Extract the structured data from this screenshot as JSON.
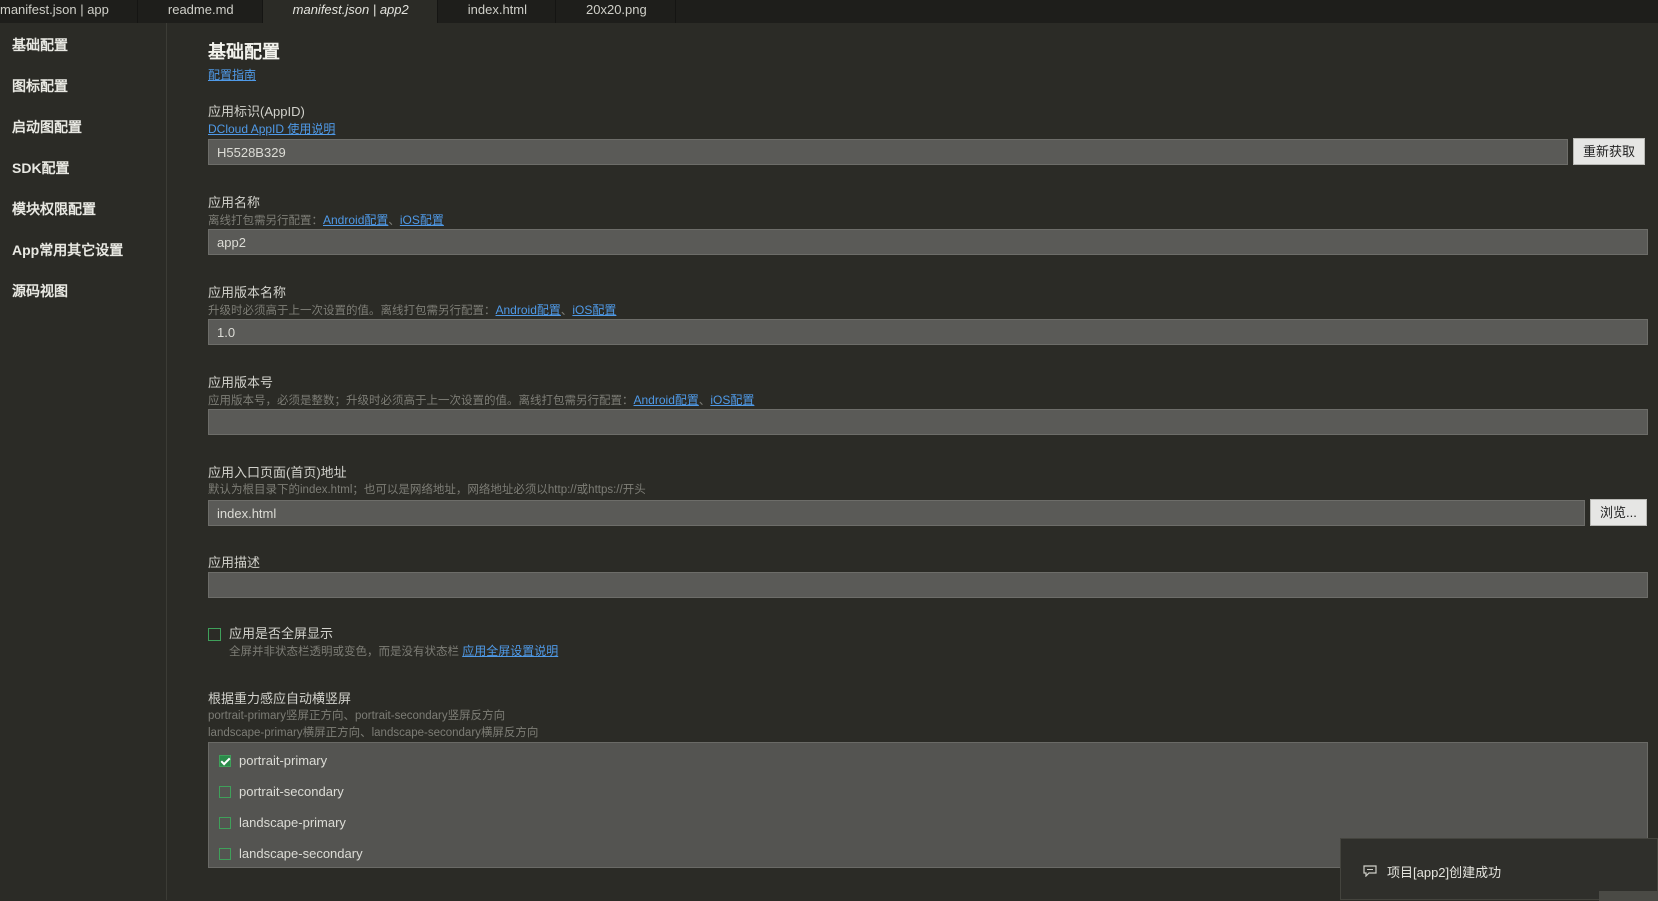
{
  "tabs": [
    {
      "label": "manifest.json | app",
      "active": false
    },
    {
      "label": "readme.md",
      "active": false
    },
    {
      "label": "manifest.json | app2",
      "active": true
    },
    {
      "label": "index.html",
      "active": false
    },
    {
      "label": "20x20.png",
      "active": false
    }
  ],
  "sidebar": {
    "items": [
      {
        "label": "基础配置"
      },
      {
        "label": "图标配置"
      },
      {
        "label": "启动图配置"
      },
      {
        "label": "SDK配置"
      },
      {
        "label": "模块权限配置"
      },
      {
        "label": "App常用其它设置"
      },
      {
        "label": "源码视图"
      }
    ]
  },
  "main": {
    "title": "基础配置",
    "guide_link": "配置指南",
    "appid": {
      "label": "应用标识(AppID)",
      "link": "DCloud AppID 使用说明",
      "value": "H5528B329",
      "button": "重新获取"
    },
    "app_name": {
      "label": "应用名称",
      "hint": "离线打包需另行配置：",
      "link_android": "Android配置",
      "sep": "、",
      "link_ios": "iOS配置",
      "value": "app2"
    },
    "version_name": {
      "label": "应用版本名称",
      "hint": "升级时必须高于上一次设置的值。离线打包需另行配置：",
      "link_android": "Android配置",
      "sep": "、",
      "link_ios": "iOS配置",
      "value": "1.0"
    },
    "version_code": {
      "label": "应用版本号",
      "hint": "应用版本号，必须是整数；升级时必须高于上一次设置的值。离线打包需另行配置：",
      "link_android": "Android配置",
      "sep": "、",
      "link_ios": "iOS配置",
      "value": ""
    },
    "entry_page": {
      "label": "应用入口页面(首页)地址",
      "hint": "默认为根目录下的index.html；也可以是网络地址，网络地址必须以http://或https://开头",
      "value": "index.html",
      "button": "浏览..."
    },
    "description": {
      "label": "应用描述",
      "value": ""
    },
    "fullscreen": {
      "label": "应用是否全屏显示",
      "hint": "全屏并非状态栏透明或变色，而是没有状态栏",
      "link": "应用全屏设置说明",
      "checked": false
    },
    "orientation": {
      "label": "根据重力感应自动横竖屏",
      "hint1": "portrait-primary竖屏正方向、portrait-secondary竖屏反方向",
      "hint2": "landscape-primary横屏正方向、landscape-secondary横屏反方向",
      "options": [
        {
          "label": "portrait-primary",
          "checked": true
        },
        {
          "label": "portrait-secondary",
          "checked": false
        },
        {
          "label": "landscape-primary",
          "checked": false
        },
        {
          "label": "landscape-secondary",
          "checked": false
        }
      ]
    }
  },
  "toast": {
    "icon": "message-icon",
    "text": "项目[app2]创建成功"
  },
  "colors": {
    "background": "#2b2b26",
    "link": "#4f9ae8",
    "input_bg": "#5a5a57",
    "checkbox_green": "#3fa05a"
  }
}
